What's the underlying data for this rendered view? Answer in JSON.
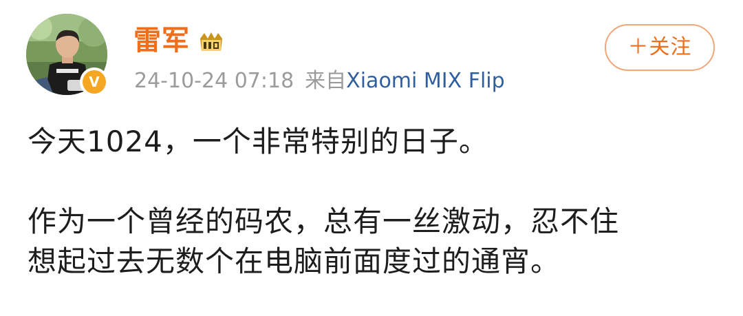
{
  "post": {
    "author": {
      "name": "雷军",
      "avatar_icon": "profile-photo-avatar",
      "verified_icon": "orange-verified-v-badge",
      "vip_icon": "vip-member-badge-icon"
    },
    "timestamp": "24-10-24 07:18",
    "source_prefix": "来自",
    "source_device": "Xiaomi MIX Flip",
    "follow_label": "＋关注",
    "text": {
      "line1": "今天1024，一个非常特别的日子。",
      "line2": "作为一个曾经的码农，总有一丝激动，忍不住",
      "line3": "想起过去无数个在电脑前面度过的通宵。"
    }
  },
  "colors": {
    "username": "#f06d1a",
    "follow_border": "#f0a678",
    "meta": "#9b9b9b",
    "link": "#2f5f9f",
    "body_text": "#1d1d1d",
    "verified": "#f5a623"
  }
}
